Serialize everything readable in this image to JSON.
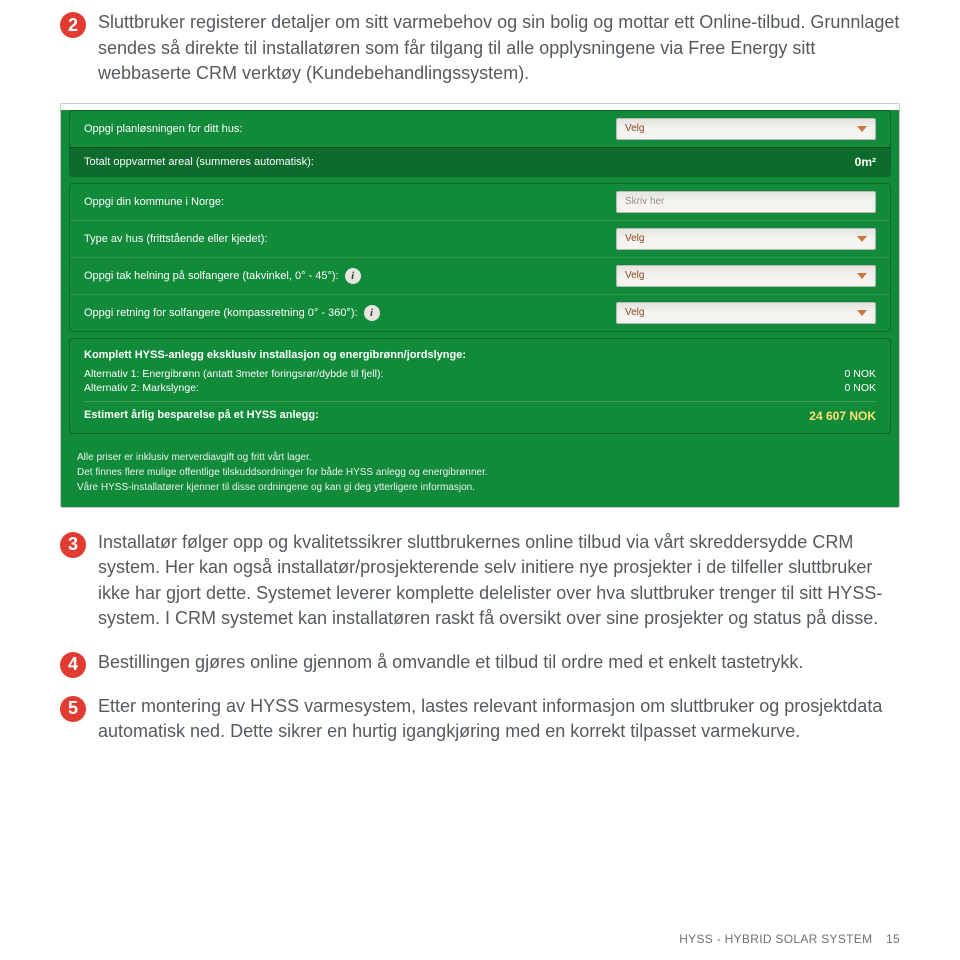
{
  "steps": {
    "s2": {
      "num": "2",
      "text": "Sluttbruker registerer detaljer om sitt varmebehov og sin bolig og mottar ett Online-tilbud. Grunnlaget sendes så direkte til installatøren som får tilgang til alle opplysningene via Free Energy sitt webbaserte CRM verktøy (Kundebehandlingssystem)."
    },
    "s3": {
      "num": "3",
      "text": "Installatør følger opp og kvalitetssikrer sluttbrukernes online tilbud via vårt skreddersydde CRM system. Her kan også installatør/prosjekterende selv initiere nye prosjekter i de tilfeller sluttbruker ikke har gjort dette. Systemet leverer komplette delelister over hva sluttbruker trenger til sitt HYSS-system. I CRM systemet kan installatøren raskt få oversikt over sine prosjekter og status på disse."
    },
    "s4": {
      "num": "4",
      "text": "Bestillingen gjøres online gjennom å omvandle et tilbud til ordre med et enkelt tastetrykk."
    },
    "s5": {
      "num": "5",
      "text": "Etter montering av HYSS varmesystem, lastes relevant informasjon om sluttbruker og prosjektdata automatisk ned. Dette sikrer en hurtig igangkjøring med en korrekt tilpasset varmekurve."
    }
  },
  "form": {
    "plan_label": "Oppgi planløsningen for ditt hus:",
    "plan_value": "Velg",
    "area_label": "Totalt oppvarmet areal (summeres automatisk):",
    "area_value": "0m²",
    "kommune_label": "Oppgi din kommune i Norge:",
    "kommune_placeholder": "Skriv her",
    "type_label": "Type av hus (frittstående eller kjedet):",
    "type_value": "Velg",
    "tak_label": "Oppgi tak helning på solfangere (takvinkel, 0° - 45°):",
    "tak_value": "Velg",
    "retning_label": "Oppgi retning for solfangere (kompassretning 0° - 360°):",
    "retning_value": "Velg",
    "price_head": "Komplett HYSS-anlegg eksklusiv installasjon og energibrønn/jordslynge:",
    "alt1": "Alternativ 1: Energibrønn (antatt 3meter foringsrør/dybde til fjell):",
    "alt1_val": "0 NOK",
    "alt2": "Alternativ 2: Markslynge:",
    "alt2_val": "0 NOK",
    "est_label": "Estimert årlig besparelse på et HYSS anlegg:",
    "est_val": "24 607 NOK",
    "fn1": "Alle priser er inklusiv merverdiavgift og fritt vårt lager.",
    "fn2": "Det finnes flere mulige offentlige tilskuddsordninger for både HYSS anlegg og energibrønner.",
    "fn3": "Våre HYSS-installatører kjenner til disse ordningene og kan gi deg ytterligere informasjon."
  },
  "footer": {
    "brand": "HYSS - HYBRID SOLAR SYSTEM",
    "page": "15"
  }
}
